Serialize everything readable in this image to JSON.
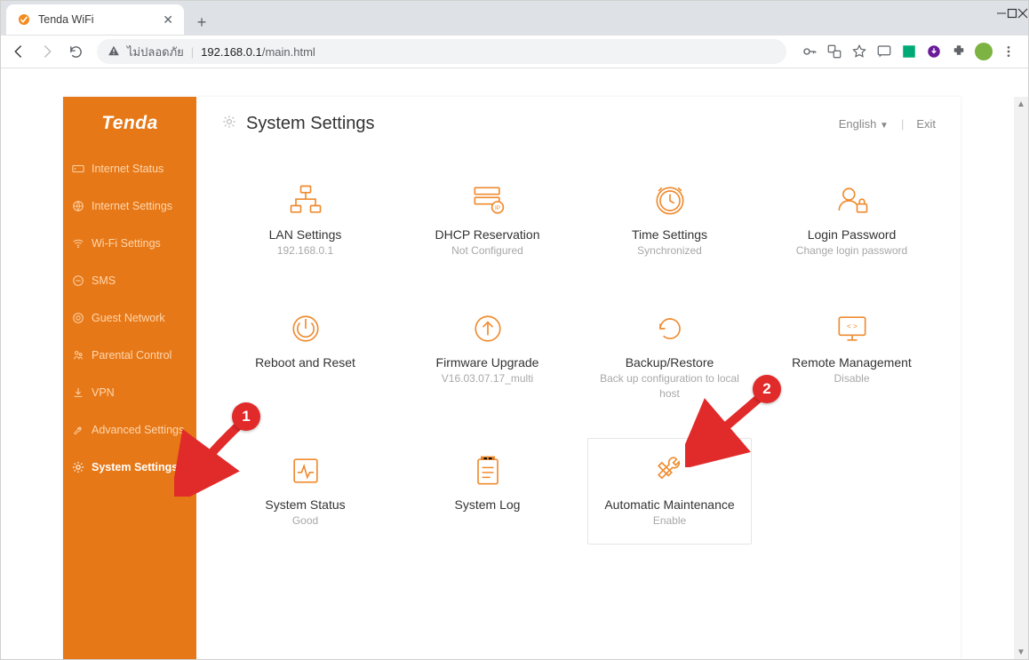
{
  "browser": {
    "tab_title": "Tenda WiFi",
    "address_security": "ไม่ปลอดภัย",
    "url_host": "192.168.0.1",
    "url_path": "/main.html"
  },
  "app": {
    "brand": "Tenda",
    "page_title": "System Settings",
    "language": "English",
    "exit": "Exit"
  },
  "sidebar": {
    "items": [
      {
        "label": "Internet Status"
      },
      {
        "label": "Internet Settings"
      },
      {
        "label": "Wi-Fi Settings"
      },
      {
        "label": "SMS"
      },
      {
        "label": "Guest Network"
      },
      {
        "label": "Parental Control"
      },
      {
        "label": "VPN"
      },
      {
        "label": "Advanced Settings"
      },
      {
        "label": "System Settings"
      }
    ],
    "active_index": 8
  },
  "tiles": [
    {
      "id": "lan",
      "title": "LAN Settings",
      "sub": "192.168.0.1"
    },
    {
      "id": "dhcp",
      "title": "DHCP Reservation",
      "sub": "Not Configured"
    },
    {
      "id": "time",
      "title": "Time Settings",
      "sub": "Synchronized"
    },
    {
      "id": "login",
      "title": "Login Password",
      "sub": "Change login password"
    },
    {
      "id": "reboot",
      "title": "Reboot and Reset",
      "sub": ""
    },
    {
      "id": "firmware",
      "title": "Firmware Upgrade",
      "sub": "V16.03.07.17_multi"
    },
    {
      "id": "backup",
      "title": "Backup/Restore",
      "sub": "Back up configuration to local host"
    },
    {
      "id": "remote",
      "title": "Remote Management",
      "sub": "Disable"
    },
    {
      "id": "status",
      "title": "System Status",
      "sub": "Good"
    },
    {
      "id": "log",
      "title": "System Log",
      "sub": ""
    },
    {
      "id": "maint",
      "title": "Automatic Maintenance",
      "sub": "Enable"
    }
  ],
  "annotations": {
    "marker1": "1",
    "marker2": "2"
  },
  "colors": {
    "orange": "#e67817",
    "icon_orange": "#ef8b2f",
    "red": "#e12a2a"
  }
}
